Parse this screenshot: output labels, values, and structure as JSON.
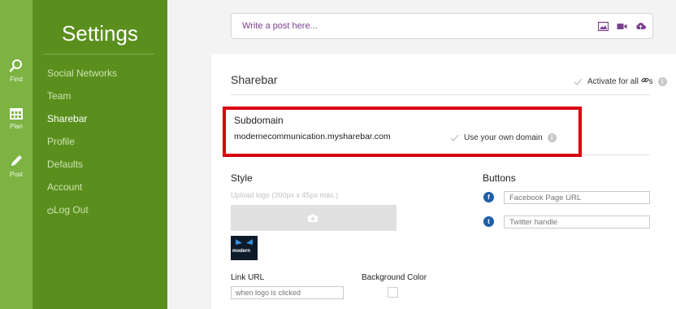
{
  "rail": {
    "items": [
      {
        "label": "Find",
        "icon": "search-icon"
      },
      {
        "label": "Plan",
        "icon": "calendar-icon"
      },
      {
        "label": "Post",
        "icon": "pencil-icon"
      }
    ]
  },
  "sidebar": {
    "title": "Settings",
    "items": [
      {
        "label": "Social Networks"
      },
      {
        "label": "Team"
      },
      {
        "label": "Sharebar",
        "active": true
      },
      {
        "label": "Profile"
      },
      {
        "label": "Defaults"
      },
      {
        "label": "Account"
      },
      {
        "label": "Log Out",
        "icon": "power-icon"
      }
    ]
  },
  "composer": {
    "placeholder": "Write a post here...",
    "icons": [
      "image-icon",
      "video-icon",
      "upload-cloud-icon"
    ]
  },
  "sharebar": {
    "title": "Sharebar",
    "activate_label": "Activate for all",
    "activate_suffix": "s",
    "subdomain_label": "Subdomain",
    "subdomain_value": "modernecommunication.mysharebar.com",
    "own_domain_label": "Use your own domain",
    "style_label": "Style",
    "upload_hint": "Upload logo (300px x 45px max.)",
    "logo_text": "modern",
    "link_url_label": "Link URL",
    "link_url_placeholder": "when logo is clicked",
    "bg_color_label": "Background Color",
    "buttons_label": "Buttons",
    "facebook_placeholder": "Facebook Page URL",
    "twitter_placeholder": "Twitter handle"
  },
  "colors": {
    "rail": "#7cb342",
    "sidebar": "#5a8f1e",
    "accent_purple": "#7b3f8f",
    "highlight_red": "#d7000f",
    "facebook_blue": "#1f5fa8",
    "twitter_blue": "#1f5fa8"
  }
}
